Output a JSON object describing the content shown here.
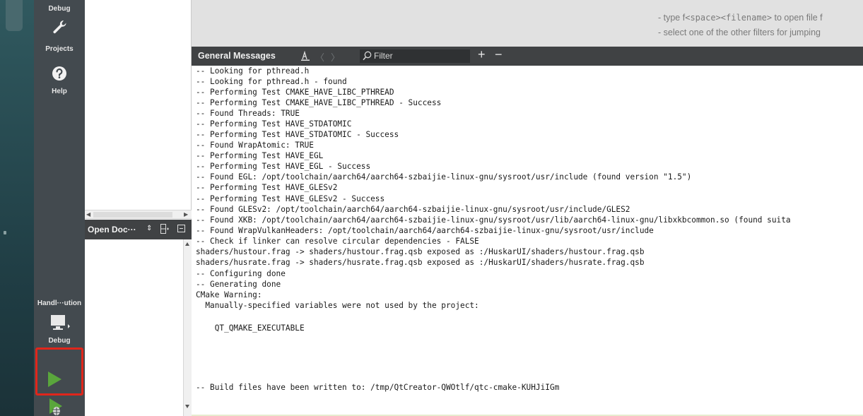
{
  "modes": {
    "debug_top_label": "Debug",
    "projects_label": "Projects",
    "help_label": "Help",
    "target_label": "Handl···ution",
    "target_config_label": "Debug"
  },
  "open_docs": {
    "title": "Open Doc···"
  },
  "locator_hints": {
    "line1_prefix": "- type f",
    "line1_mono": "<space><filename>",
    "line1_suffix": " to open file f",
    "line2": "- select one of the other filters for jumping"
  },
  "output_pane": {
    "title": "General Messages",
    "filter_placeholder": "Filter",
    "add_label": "+",
    "remove_label": "−"
  },
  "log_lines": [
    "-- Looking for pthread.h",
    "-- Looking for pthread.h - found",
    "-- Performing Test CMAKE_HAVE_LIBC_PTHREAD",
    "-- Performing Test CMAKE_HAVE_LIBC_PTHREAD - Success",
    "-- Found Threads: TRUE",
    "-- Performing Test HAVE_STDATOMIC",
    "-- Performing Test HAVE_STDATOMIC - Success",
    "-- Found WrapAtomic: TRUE",
    "-- Performing Test HAVE_EGL",
    "-- Performing Test HAVE_EGL - Success",
    "-- Found EGL: /opt/toolchain/aarch64/aarch64-szbaijie-linux-gnu/sysroot/usr/include (found version \"1.5\")",
    "-- Performing Test HAVE_GLESv2",
    "-- Performing Test HAVE_GLESv2 - Success",
    "-- Found GLESv2: /opt/toolchain/aarch64/aarch64-szbaijie-linux-gnu/sysroot/usr/include/GLES2",
    "-- Found XKB: /opt/toolchain/aarch64/aarch64-szbaijie-linux-gnu/sysroot/usr/lib/aarch64-linux-gnu/libxkbcommon.so (found suita",
    "-- Found WrapVulkanHeaders: /opt/toolchain/aarch64/aarch64-szbaijie-linux-gnu/sysroot/usr/include",
    "-- Check if linker can resolve circular dependencies - FALSE",
    "shaders/hustour.frag -> shaders/hustour.frag.qsb exposed as :/HuskarUI/shaders/hustour.frag.qsb",
    "shaders/husrate.frag -> shaders/husrate.frag.qsb exposed as :/HuskarUI/shaders/husrate.frag.qsb",
    "-- Configuring done",
    "-- Generating done",
    "CMake Warning:",
    "  Manually-specified variables were not used by the project:",
    "",
    "    QT_QMAKE_EXECUTABLE",
    "",
    "",
    "",
    "-- Build files have been written to: /tmp/QtCreator-QWOtlf/qtc-cmake-KUHJiIGm"
  ],
  "colors": {
    "sidebar": "#434a4f",
    "run_green": "#5aa63c",
    "highlight_red": "#e0261b"
  }
}
